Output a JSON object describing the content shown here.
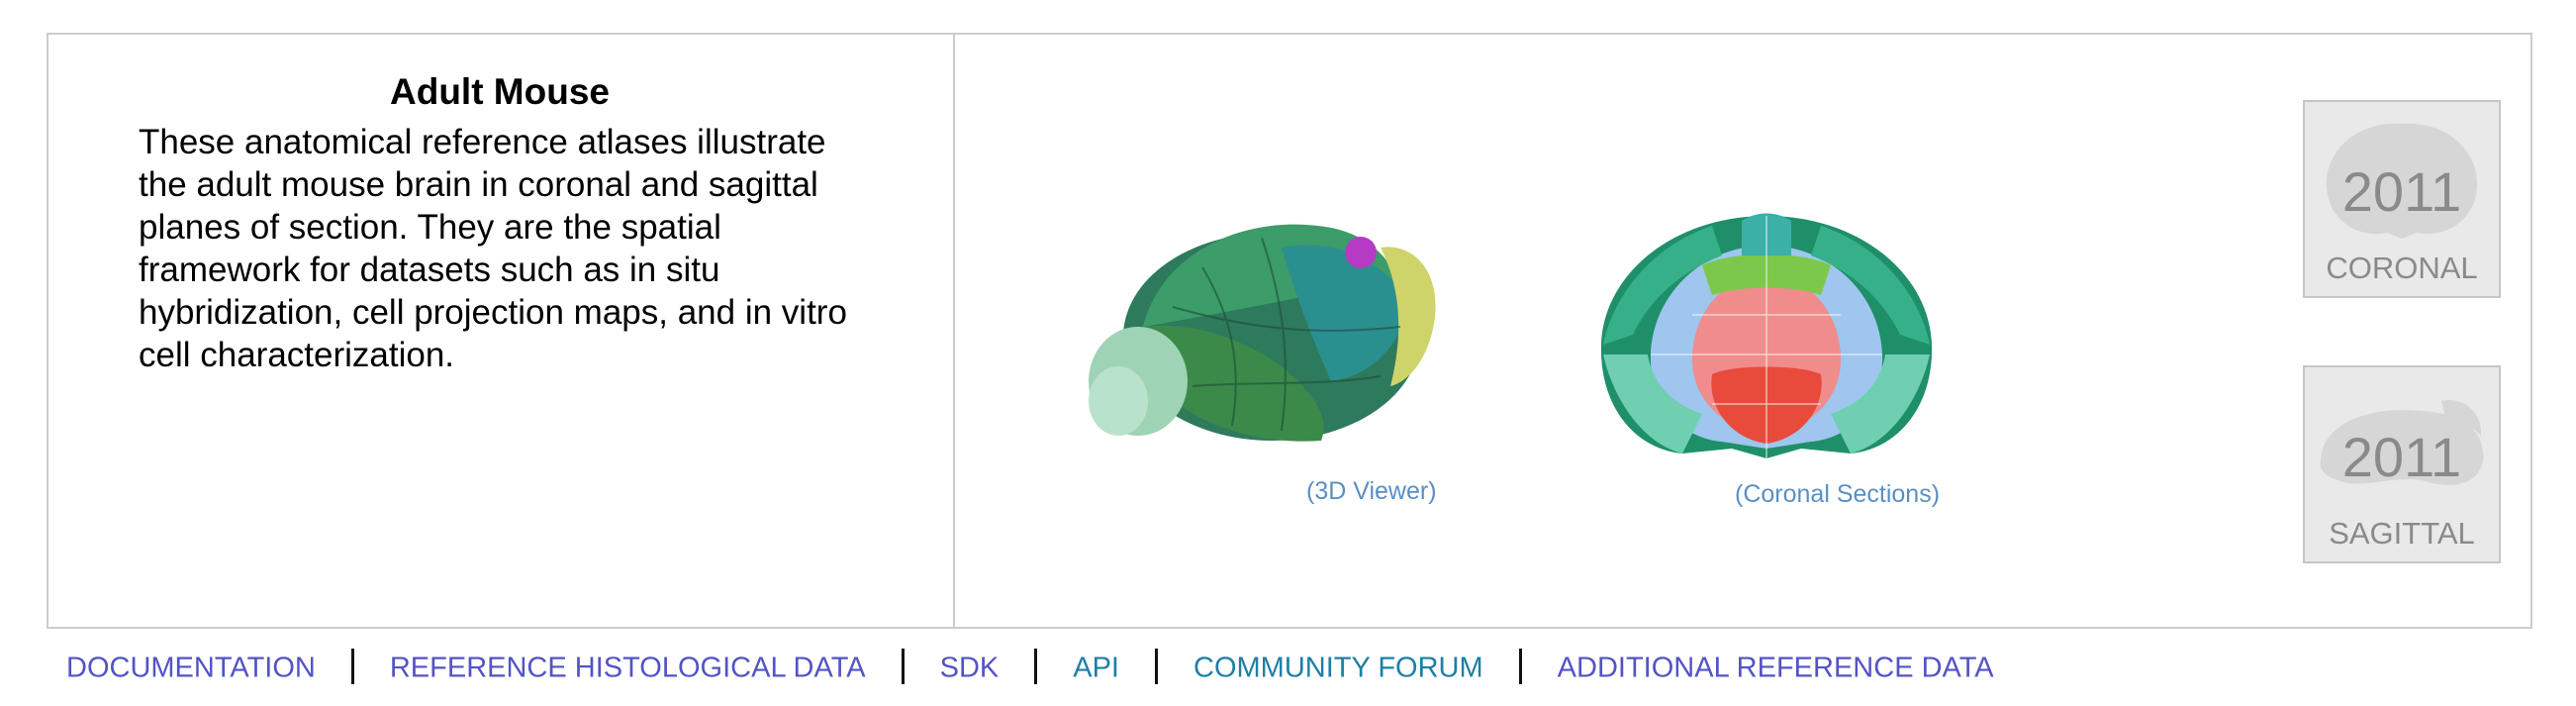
{
  "header": {
    "title": "Adult Mouse",
    "description": "These anatomical reference atlases illustrate the adult mouse brain in coronal and sagittal planes of section. They are the spatial framework for datasets such as in situ hybridization, cell projection maps, and in vitro cell characterization."
  },
  "viewers": {
    "viewer3d_caption": "(3D Viewer)",
    "coronal_caption": "(Coronal Sections)"
  },
  "atlases": [
    {
      "year": "2011",
      "label": "CORONAL"
    },
    {
      "year": "2011",
      "label": "SAGITTAL"
    }
  ],
  "nav": {
    "items": [
      "DOCUMENTATION",
      "REFERENCE HISTOLOGICAL DATA",
      "SDK",
      "API",
      "COMMUNITY FORUM",
      "ADDITIONAL REFERENCE DATA"
    ]
  },
  "colors": {
    "link": "#5353c6",
    "link_teal": "#1e7fa6",
    "caption": "#5b8fc4",
    "tile_bg": "#e9e9e9",
    "border": "#cccccc"
  }
}
